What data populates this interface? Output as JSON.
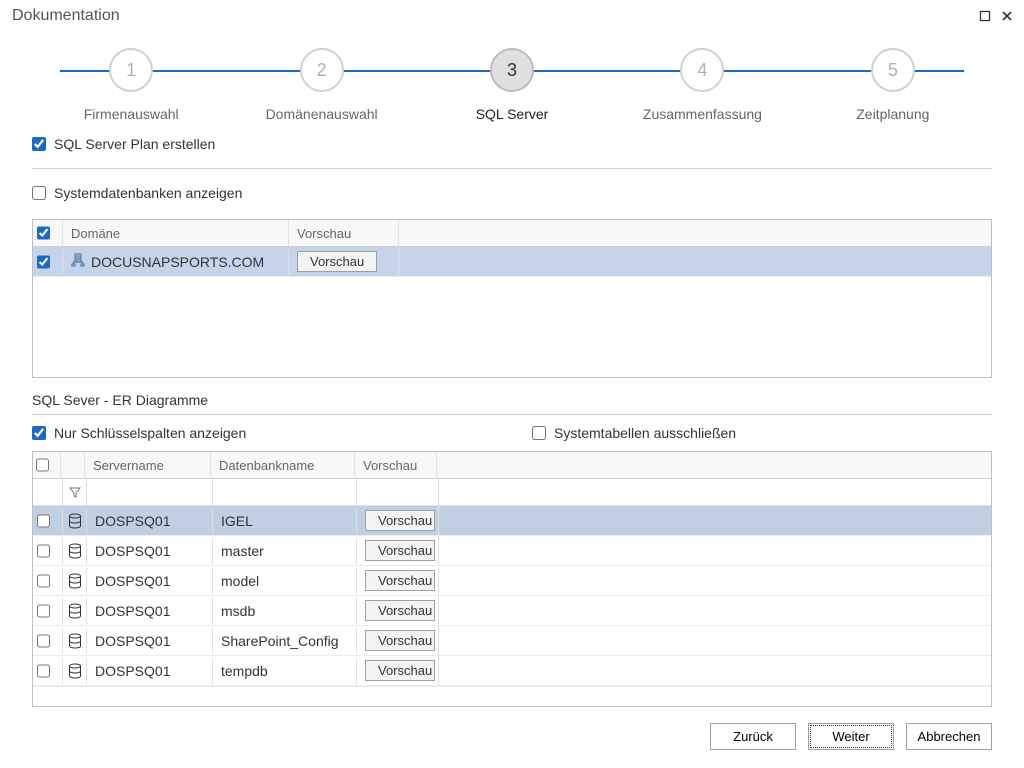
{
  "window": {
    "title": "Dokumentation"
  },
  "wizard": {
    "steps": [
      {
        "num": "1",
        "label": "Firmenauswahl"
      },
      {
        "num": "2",
        "label": "Domänenauswahl"
      },
      {
        "num": "3",
        "label": "SQL Server"
      },
      {
        "num": "4",
        "label": "Zusammenfassung"
      },
      {
        "num": "5",
        "label": "Zeitplanung"
      }
    ],
    "active_index": 2
  },
  "check_plan": "SQL Server Plan erstellen",
  "check_sysdb": "Systemdatenbanken anzeigen",
  "domain_table": {
    "headers": {
      "domain": "Domäne",
      "preview": "Vorschau"
    },
    "rows": [
      {
        "domain": "DOCUSNAPSPORTS.COM",
        "preview_btn": "Vorschau"
      }
    ]
  },
  "section2_title": "SQL Sever - ER Diagramme",
  "check_keycols": "Nur Schlüsselspalten anzeigen",
  "check_systables": "Systemtabellen ausschließen",
  "db_table": {
    "headers": {
      "server": "Servername",
      "db": "Datenbankname",
      "preview": "Vorschau"
    },
    "preview_btn": "Vorschau",
    "rows": [
      {
        "server": "DOSPSQ01",
        "db": "IGEL"
      },
      {
        "server": "DOSPSQ01",
        "db": "master"
      },
      {
        "server": "DOSPSQ01",
        "db": "model"
      },
      {
        "server": "DOSPSQ01",
        "db": "msdb"
      },
      {
        "server": "DOSPSQ01",
        "db": "SharePoint_Config"
      },
      {
        "server": "DOSPSQ01",
        "db": "tempdb"
      }
    ]
  },
  "footer": {
    "back": "Zurück",
    "next": "Weiter",
    "cancel": "Abbrechen"
  }
}
